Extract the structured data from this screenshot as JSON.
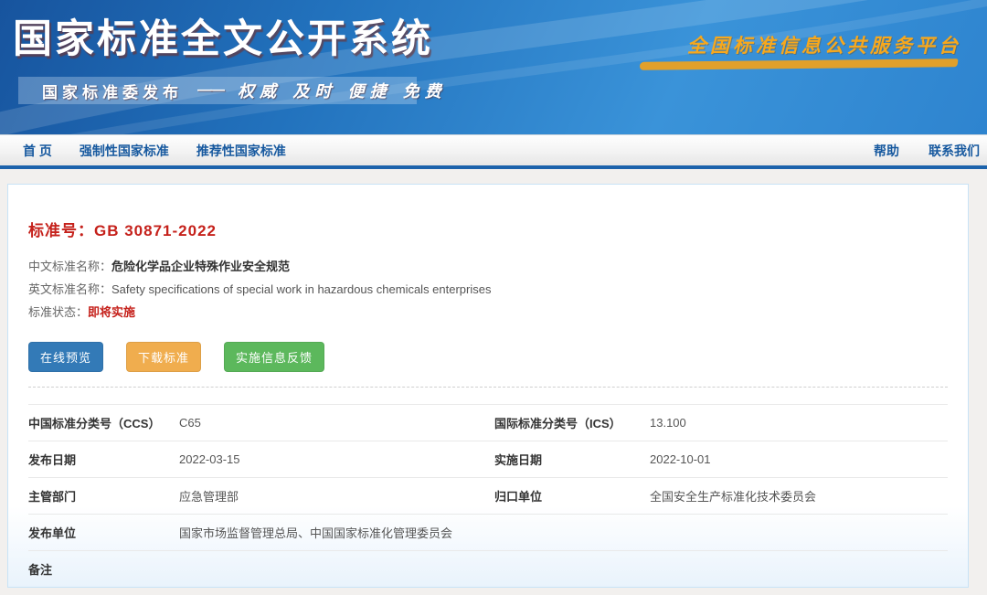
{
  "header": {
    "title": "国家标准全文公开系统",
    "slogan": "全国标准信息公共服务平台",
    "publisher": "国家标准委发布",
    "dash": "——",
    "motto": "权威 及时 便捷 免费",
    "colors": {
      "banner_top": "#17549e",
      "banner_bottom": "#3a93d9",
      "slogan_orange": "#f7a81d"
    }
  },
  "nav": {
    "left": [
      {
        "label": "首 页"
      },
      {
        "label": "强制性国家标准"
      },
      {
        "label": "推荐性国家标准"
      }
    ],
    "right": [
      {
        "label": "帮助"
      },
      {
        "label": "联系我们"
      }
    ],
    "text_color": "#17599f",
    "underline_color": "#1b62ab"
  },
  "standard": {
    "number_label": "标准号：",
    "number": "GB 30871-2022",
    "number_color": "#c5211b",
    "cn_name_label": "中文标准名称：",
    "cn_name": "危险化学品企业特殊作业安全规范",
    "en_name_label": "英文标准名称：",
    "en_name": "Safety specifications of special work in hazardous chemicals enterprises",
    "status_label": "标准状态：",
    "status": "即将实施",
    "status_color": "#c5211b"
  },
  "buttons": [
    {
      "label": "在线预览",
      "bg": "#337ab7"
    },
    {
      "label": "下载标准",
      "bg": "#f0ad4e"
    },
    {
      "label": "实施信息反馈",
      "bg": "#5cb85c"
    }
  ],
  "details": {
    "rows": [
      {
        "cells": [
          {
            "label": "中国标准分类号（CCS）",
            "value": "C65"
          },
          {
            "label": "国际标准分类号（ICS）",
            "value": "13.100"
          }
        ]
      },
      {
        "cells": [
          {
            "label": "发布日期",
            "value": "2022-03-15"
          },
          {
            "label": "实施日期",
            "value": "2022-10-01"
          }
        ]
      },
      {
        "cells": [
          {
            "label": "主管部门",
            "value": "应急管理部"
          },
          {
            "label": "归口单位",
            "value": "全国安全生产标准化技术委员会"
          }
        ]
      },
      {
        "cells": [
          {
            "label": "发布单位",
            "value": "国家市场监督管理总局、中国国家标准化管理委员会"
          }
        ]
      },
      {
        "cells": [
          {
            "label": "备注",
            "value": ""
          }
        ]
      }
    ]
  }
}
